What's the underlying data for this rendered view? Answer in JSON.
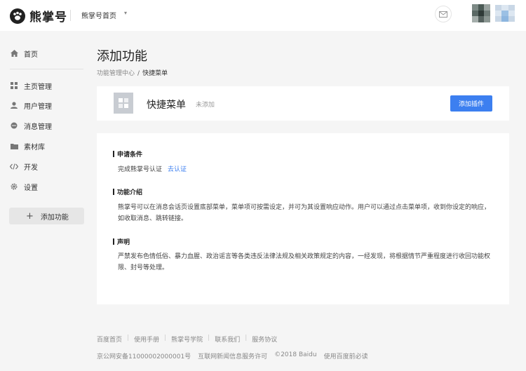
{
  "header": {
    "logo_text": "熊掌号",
    "account_name": "熊掌号首页",
    "caret": "▾"
  },
  "sidebar": {
    "items": [
      {
        "label": "首页"
      },
      {
        "label": "主页管理"
      },
      {
        "label": "用户管理"
      },
      {
        "label": "消息管理"
      },
      {
        "label": "素材库"
      },
      {
        "label": "开发"
      },
      {
        "label": "设置"
      }
    ],
    "add_function": "添加功能"
  },
  "main": {
    "title": "添加功能",
    "breadcrumb": {
      "parent": "功能管理中心",
      "separator": "/",
      "current": "快捷菜单"
    },
    "feature": {
      "name": "快捷菜单",
      "status": "未添加",
      "add_button": "添加插件"
    },
    "sections": {
      "requirement": {
        "title": "申请条件",
        "text": "完成熊掌号认证",
        "link": "去认证"
      },
      "intro": {
        "title": "功能介绍",
        "text": "熊掌号可以在消息会话页设置底部菜单，菜单项可按需设定，并可为其设置响应动作。用户可以通过点击菜单项，收到你设定的响应，如收取消息、跳转链接。"
      },
      "statement": {
        "title": "声明",
        "text": "严禁发布色情低俗、暴力血腥、政治谣言等各类违反法律法规及相关政策规定的内容，一经发现，将根据情节严重程度进行收回功能权限、封号等处理。"
      }
    }
  },
  "footer": {
    "links": [
      "百度首页",
      "使用手册",
      "熊掌号学院",
      "联系我们",
      "服务协议"
    ],
    "separator": "|",
    "copy": [
      "京公网安备11000002000001号",
      "互联网新闻信息服务许可",
      "©2018 Baidu",
      "使用百度前必读"
    ]
  },
  "colors": {
    "accent": "#3c7ff0",
    "page_bg": "#f5f5f5",
    "card_bg": "#ffffff"
  }
}
